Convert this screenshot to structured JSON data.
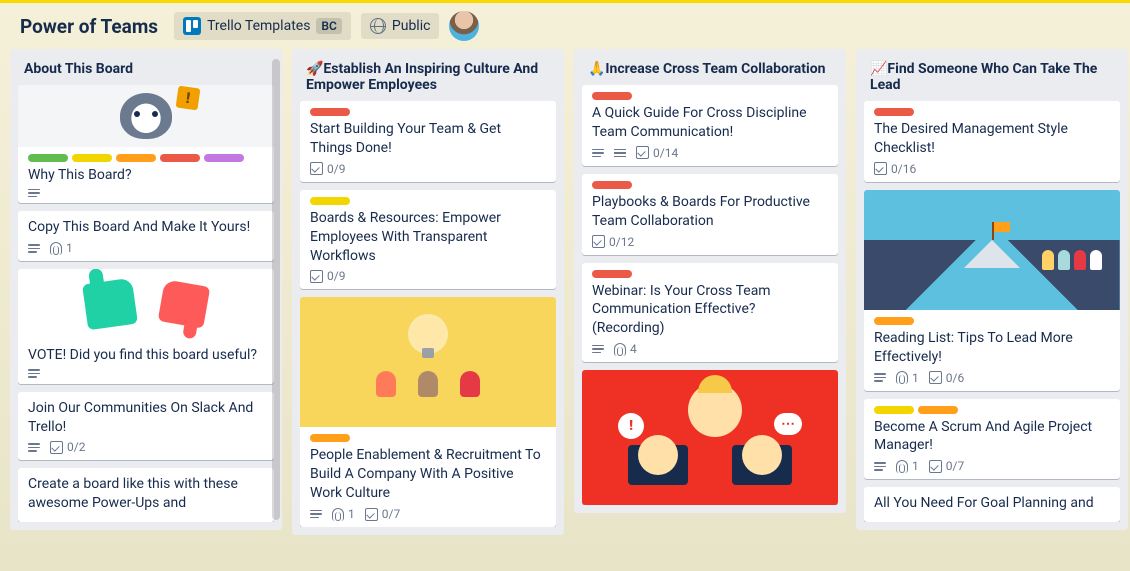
{
  "header": {
    "board_title": "Power of Teams",
    "templates_label": "Trello Templates",
    "bc_badge": "BC",
    "visibility_label": "Public"
  },
  "lists": [
    {
      "title": "About This Board",
      "cards": [
        {
          "cover": "husky",
          "labels": [
            "green",
            "yellow",
            "orange",
            "red",
            "purple"
          ],
          "title": "Why This Board?",
          "badges": {
            "desc": true
          }
        },
        {
          "title": "Copy This Board And Make It Yours!",
          "badges": {
            "desc": true,
            "attach": "1"
          }
        },
        {
          "cover": "vote",
          "title": "VOTE! Did you find this board useful?",
          "badges": {
            "desc": true
          }
        },
        {
          "title": "Join Our Communities On Slack And Trello!",
          "badges": {
            "desc": true,
            "check": "0/2"
          }
        },
        {
          "title": "Create a board like this with these awesome Power-Ups and"
        }
      ]
    },
    {
      "title": "🚀Establish An Inspiring Culture And Empower Employees",
      "cards": [
        {
          "labels": [
            "red"
          ],
          "title": "Start Building Your Team & Get Things Done!",
          "badges": {
            "check": "0/9"
          }
        },
        {
          "labels": [
            "yellow"
          ],
          "title": "Boards & Resources: Empower Employees With Transparent Workflows",
          "badges": {
            "check": "0/9"
          }
        },
        {
          "cover": "idea",
          "labels": [
            "orange"
          ],
          "title": "People Enablement & Recruitment To Build A Company With A Positive Work Culture",
          "badges": {
            "desc": true,
            "attach": "1",
            "check": "0/7"
          }
        }
      ]
    },
    {
      "title": "🙏Increase Cross Team Collaboration",
      "cards": [
        {
          "labels": [
            "red"
          ],
          "title": "A Quick Guide For Cross Discipline Team Communication!",
          "badges": {
            "desc": true,
            "list": true,
            "check": "0/14"
          }
        },
        {
          "labels": [
            "red"
          ],
          "title": "Playbooks & Boards For Productive Team Collaboration",
          "badges": {
            "check": "0/12"
          }
        },
        {
          "labels": [
            "red"
          ],
          "title": "Webinar: Is Your Cross Team Communication Effective? (Recording)",
          "badges": {
            "desc": true,
            "attach": "4"
          }
        },
        {
          "cover": "red"
        }
      ]
    },
    {
      "title": "📈Find Someone Who Can Take The Lead",
      "cards": [
        {
          "labels": [
            "red"
          ],
          "title": "The Desired Management Style Checklist!",
          "badges": {
            "check": "0/16"
          }
        },
        {
          "cover": "mountain",
          "labels": [
            "orange"
          ],
          "title": "Reading List: Tips To Lead More Effectively!",
          "badges": {
            "desc": true,
            "attach": "1",
            "check": "0/6"
          }
        },
        {
          "labels": [
            "yellow",
            "orange"
          ],
          "title": "Become A Scrum And Agile Project Manager!",
          "badges": {
            "desc": true,
            "attach": "1",
            "check": "0/7"
          }
        },
        {
          "title": "All You Need For Goal Planning and"
        }
      ]
    }
  ]
}
